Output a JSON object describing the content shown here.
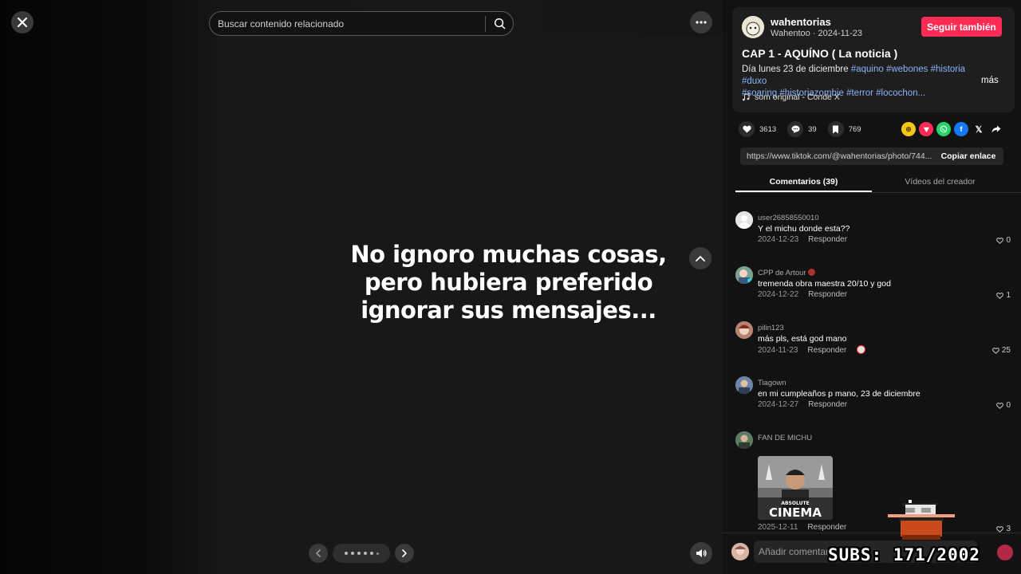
{
  "viewer": {
    "search": {
      "placeholder": "Buscar contenido relacionado"
    },
    "caption": "No ignoro muchas cosas, pero hubiera preferido ignorar sus mensajes...",
    "slide_dots": 6
  },
  "post": {
    "username": "wahentorias",
    "display_name": "Wahentoo",
    "date": "2024-11-23",
    "follow_label": "Seguir también",
    "title": "CAP 1 - AQUÍNO ( La noticia )",
    "desc_prefix": "Día lunes 23 de diciembre ",
    "tags": [
      "#aquino",
      "#webones",
      "#historia",
      "#duxo",
      "#soaring",
      "#historiazombie",
      "#terror",
      "#locochon..."
    ],
    "more_label": "más",
    "music": "som original - Conde X",
    "likes": "3613",
    "comments_count": "39",
    "saves": "769",
    "link": "https://www.tiktok.com/@wahentorias/photo/744...",
    "copy_label": "Copiar enlace"
  },
  "tabs": [
    {
      "label": "Comentarios (39)",
      "active": true
    },
    {
      "label": "Vídeos del creador",
      "active": false
    }
  ],
  "comments": [
    {
      "user": "user26858550010",
      "text": "Y el michu donde esta??",
      "date": "2024-12-23",
      "reply": "Responder",
      "likes": "0"
    },
    {
      "user": "CPP de Artour",
      "text": "tremenda obra maestra 20/10 y god",
      "date": "2024-12-22",
      "reply": "Responder",
      "likes": "1"
    },
    {
      "user": "pilin123",
      "text": "más pls, está god mano",
      "date": "2024-11-23",
      "reply": "Responder",
      "likes": "25"
    },
    {
      "user": "Tiagown",
      "text": "en mi cumpleaños p mano, 23 de diciembre",
      "date": "2024-12-27",
      "reply": "Responder",
      "likes": "0"
    },
    {
      "user": "FAN DE MICHU",
      "text": "",
      "gif_top": "ABSOLUTE",
      "gif_bottom": "CINEMA",
      "date": "2025-12-11",
      "reply": "Responder",
      "likes": "3"
    }
  ],
  "comment_input": {
    "placeholder": "Añadir comentario..."
  },
  "overlay": {
    "subs": "SUBS: 171/2002"
  },
  "colors": {
    "accent": "#fe2c55",
    "hashtag": "#8ab4f8",
    "panel": "#121212"
  }
}
